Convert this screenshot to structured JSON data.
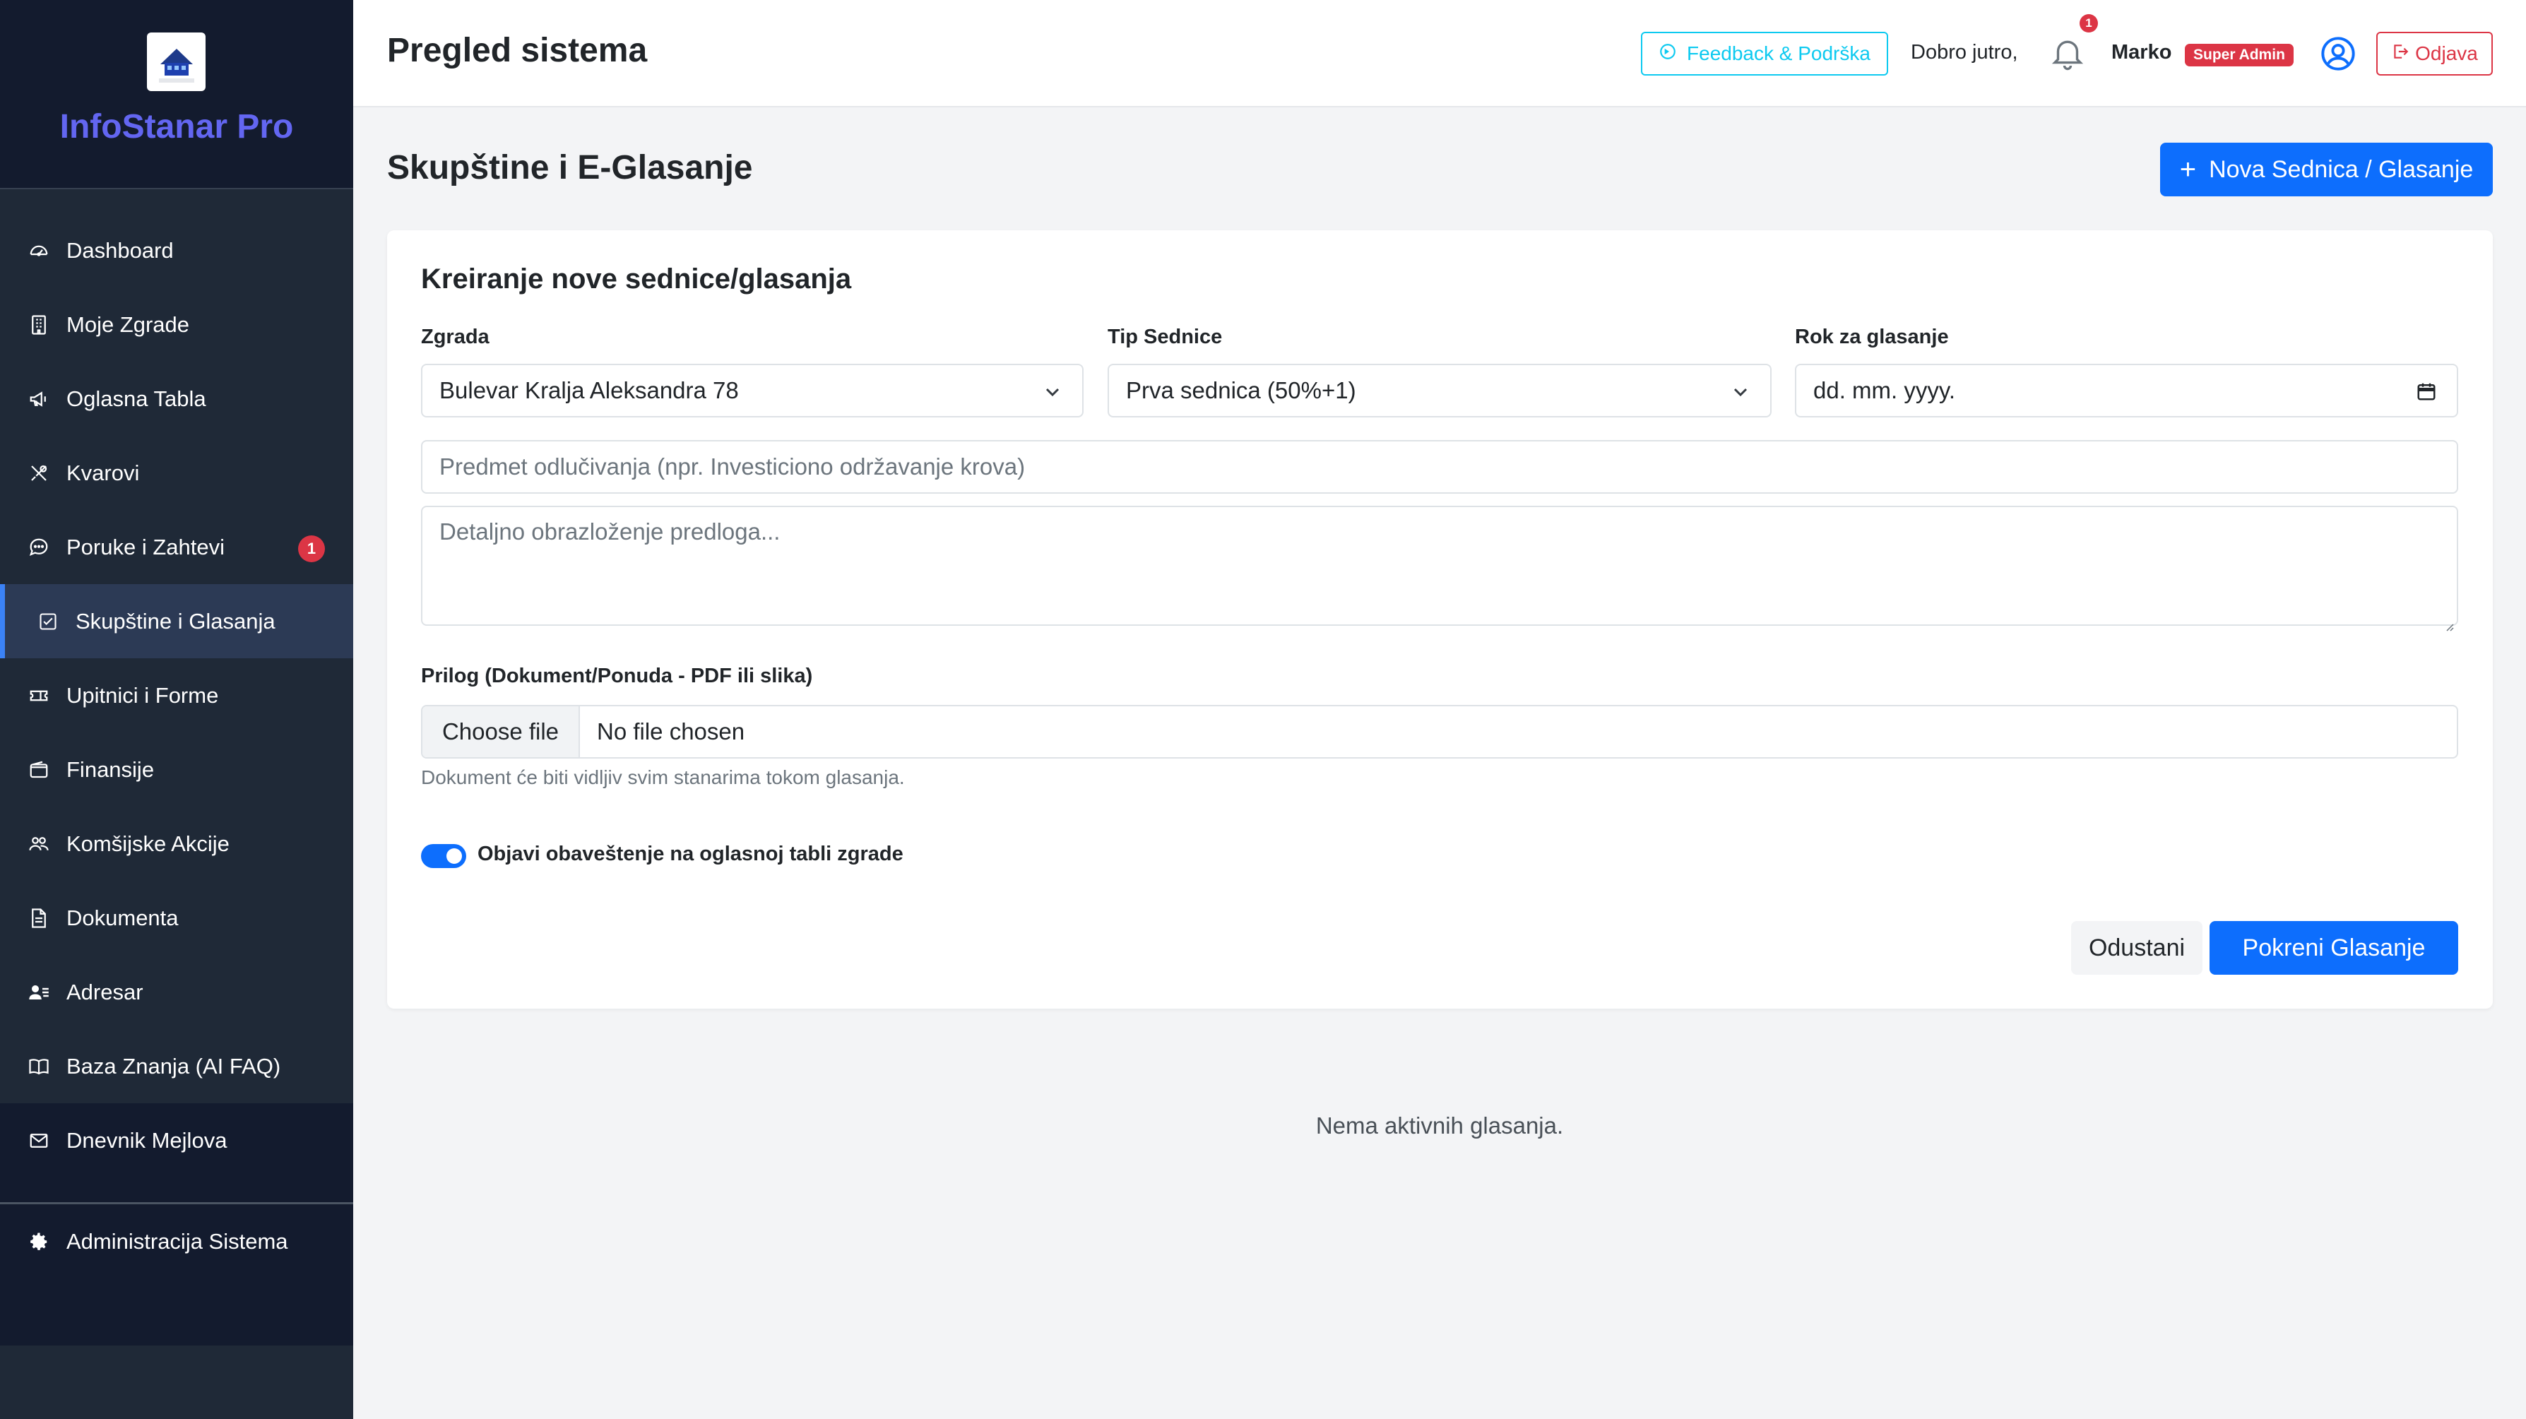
{
  "app": {
    "brand": "InfoStanar Pro",
    "logo_text": "InfoStanar"
  },
  "sidebar": {
    "items": [
      {
        "label": "Dashboard",
        "icon": "speedometer-icon"
      },
      {
        "label": "Moje Zgrade",
        "icon": "building-icon"
      },
      {
        "label": "Oglasna Tabla",
        "icon": "megaphone-icon"
      },
      {
        "label": "Kvarovi",
        "icon": "tools-icon"
      },
      {
        "label": "Poruke i Zahtevi",
        "icon": "chat-icon",
        "badge": "1"
      },
      {
        "label": "Skupštine i Glasanja",
        "icon": "checkbox-icon",
        "active": true
      },
      {
        "label": "Upitnici i Forme",
        "icon": "ticket-icon"
      },
      {
        "label": "Finansije",
        "icon": "wallet-icon"
      },
      {
        "label": "Komšijske Akcije",
        "icon": "people-icon"
      },
      {
        "label": "Dokumenta",
        "icon": "document-icon"
      },
      {
        "label": "Adresar",
        "icon": "contacts-icon"
      },
      {
        "label": "Baza Znanja (AI FAQ)",
        "icon": "book-icon"
      },
      {
        "label": "Dnevnik Mejlova",
        "icon": "envelope-icon"
      }
    ],
    "admin": {
      "label": "Administracija Sistema",
      "icon": "gear-icon"
    }
  },
  "topbar": {
    "title": "Pregled sistema",
    "feedback_label": "Feedback & Podrška",
    "greeting": "Dobro jutro,",
    "notification_count": "1",
    "user_name": "Marko",
    "role": "Super Admin",
    "logout_label": "Odjava"
  },
  "page": {
    "title": "Skupštine i E-Glasanje",
    "new_button": "Nova Sednica / Glasanje",
    "empty_message": "Nema aktivnih glasanja."
  },
  "form": {
    "title": "Kreiranje nove sednice/glasanja",
    "building_label": "Zgrada",
    "building_value": "Bulevar Kralja Aleksandra 78",
    "type_label": "Tip Sednice",
    "type_value": "Prva sednica (50%+1)",
    "deadline_label": "Rok za glasanje",
    "deadline_placeholder": "dd. mm. yyyy.",
    "subject_placeholder": "Predmet odlučivanja (npr. Investiciono održavanje krova)",
    "details_placeholder": "Detaljno obrazloženje predloga...",
    "attachment_label": "Prilog (Dokument/Ponuda - PDF ili slika)",
    "file_button": "Choose file",
    "file_status": "No file chosen",
    "attachment_help": "Dokument će biti vidljiv svim stanarima tokom glasanja.",
    "publish_toggle_label": "Objavi obaveštenje na oglasnoj tabli zgrade",
    "publish_toggle_on": true,
    "cancel_label": "Odustani",
    "submit_label": "Pokreni Glasanje"
  },
  "colors": {
    "sidebar_bg": "#1f2937",
    "sidebar_dark": "#131b2e",
    "brand": "#6366f1",
    "primary": "#0d6efd",
    "danger": "#dc3545",
    "info": "#0dcaf0"
  }
}
